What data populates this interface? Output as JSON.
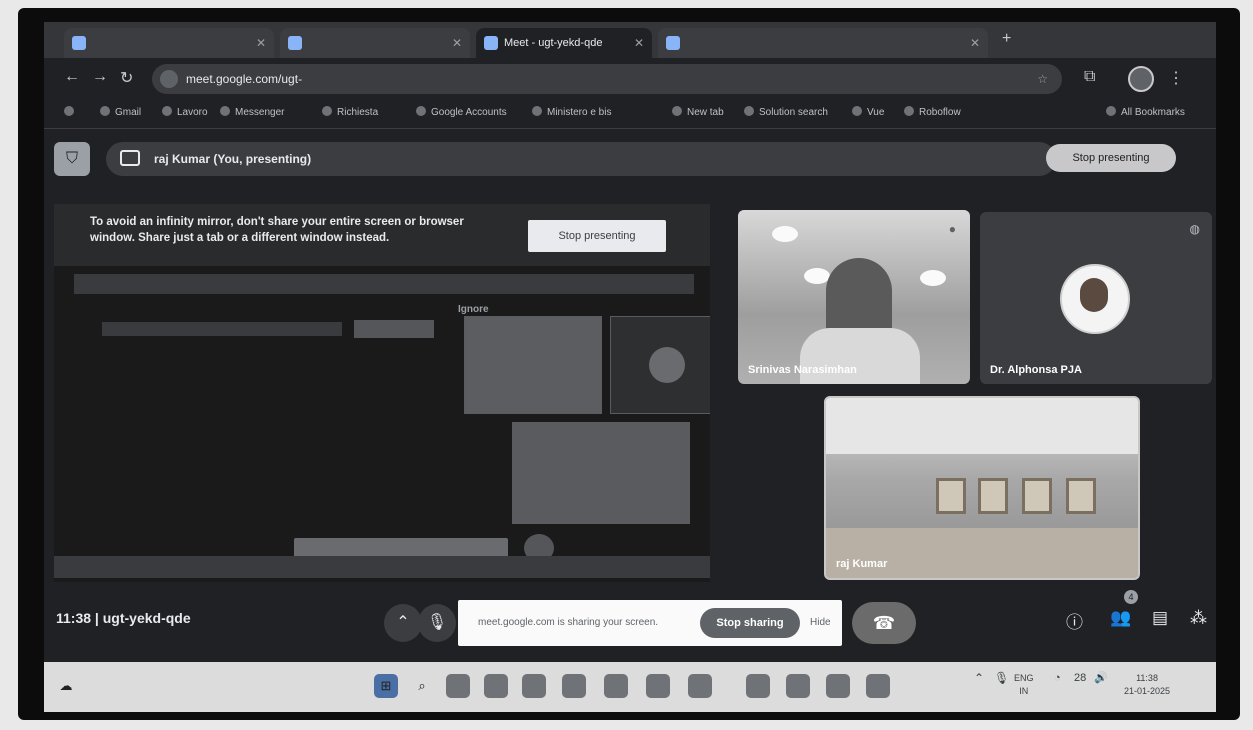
{
  "browser": {
    "tabs": [
      {
        "label": ""
      },
      {
        "label": ""
      },
      {
        "label": "Meet - ugt-yekd-qde",
        "active": true
      },
      {
        "label": ""
      }
    ],
    "url": "meet.google.com/ugt-",
    "bookmarks": [
      "Gmail",
      "Lavoro",
      "Messenger",
      "Richiesta",
      "Google Accounts",
      "Ministero e bis",
      "New tab",
      "Solution search",
      "Vue",
      "Roboflow",
      "All Bookmarks"
    ]
  },
  "presenting": {
    "label": "raj Kumar (You, presenting)",
    "stop_label": "Stop presenting"
  },
  "mirror": {
    "warning": "To avoid an infinity mirror, don't share your entire screen or browser window. Share just a tab or a different window instead.",
    "stop_label": "Stop presenting",
    "nested_label": "Ignore"
  },
  "participants": [
    {
      "name": "Srinivas Narasimhan"
    },
    {
      "name": "Dr. Alphonsa PJA"
    },
    {
      "name": "raj Kumar"
    }
  ],
  "meetbar": {
    "time": "11:38",
    "meeting_code": "ugt-yekd-qde",
    "sharing_info": "meet.google.com is sharing your screen.",
    "stop_sharing": "Stop sharing",
    "hide": "Hide",
    "people_count": "4"
  },
  "taskbar": {
    "lang": "ENG",
    "region": "IN",
    "temp": "28",
    "clock": "11:38",
    "date": "21-01-2025"
  }
}
